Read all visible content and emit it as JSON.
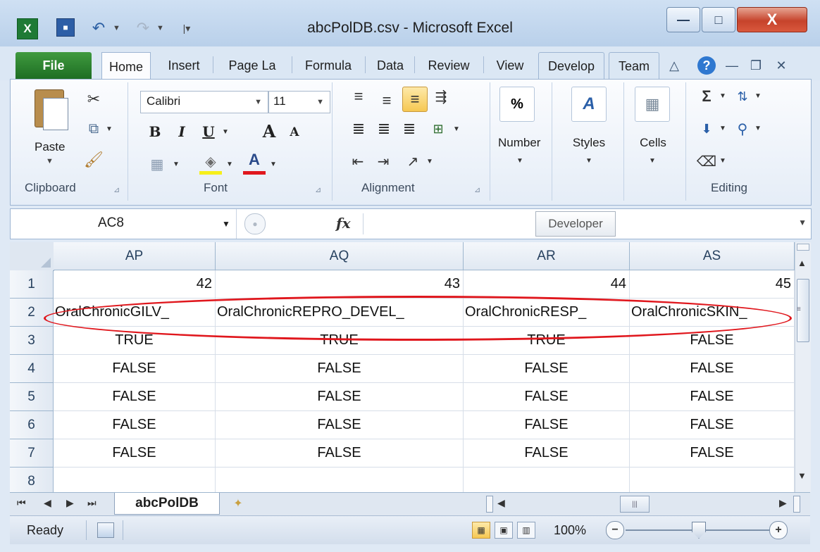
{
  "app": {
    "title": "abcPolDB.csv - Microsoft Excel",
    "logo": "X",
    "colors": {
      "excel_green": "#1f7a35",
      "annotation_red": "#e0171d",
      "ribbon_bg": "#dbe7f4"
    }
  },
  "window_controls": {
    "minimize": "—",
    "maximize": "□",
    "close": "X"
  },
  "tabs": [
    {
      "label": "File"
    },
    {
      "label": "Home"
    },
    {
      "label": "Insert"
    },
    {
      "label": "Page La"
    },
    {
      "label": "Formula"
    },
    {
      "label": "Data"
    },
    {
      "label": "Review"
    },
    {
      "label": "View"
    },
    {
      "label": "Develop"
    },
    {
      "label": "Team"
    }
  ],
  "ribbon": {
    "clipboard": {
      "label": "Clipboard",
      "paste_label": "Paste"
    },
    "font": {
      "label": "Font",
      "font_name": "Calibri",
      "font_size": "11",
      "bold": "B",
      "italic": "I",
      "underline": "U",
      "grow": "A",
      "shrink": "A"
    },
    "alignment": {
      "label": "Alignment"
    },
    "number": {
      "label": "Number",
      "icon_text": "%"
    },
    "styles": {
      "label": "Styles"
    },
    "cells": {
      "label": "Cells"
    },
    "editing": {
      "label": "Editing",
      "sum": "Σ"
    }
  },
  "formula_bar": {
    "name_box": "AC8",
    "fx": "fx",
    "formula": "",
    "tooltip": "Developer"
  },
  "sheet": {
    "columns": [
      "AP",
      "AQ",
      "AR",
      "AS"
    ],
    "rows": [
      "1",
      "2",
      "3",
      "4",
      "5",
      "6",
      "7",
      "8"
    ],
    "cells": [
      [
        "42",
        "43",
        "44",
        "45"
      ],
      [
        "OralChronicGILV_",
        "OralChronicREPRO_DEVEL_",
        "OralChronicRESP_",
        "OralChronicSKIN_"
      ],
      [
        "TRUE",
        "TRUE",
        "TRUE",
        "FALSE"
      ],
      [
        "FALSE",
        "FALSE",
        "FALSE",
        "FALSE"
      ],
      [
        "FALSE",
        "FALSE",
        "FALSE",
        "FALSE"
      ],
      [
        "FALSE",
        "FALSE",
        "FALSE",
        "FALSE"
      ],
      [
        "FALSE",
        "FALSE",
        "FALSE",
        "FALSE"
      ],
      [
        "",
        "",
        "",
        ""
      ]
    ],
    "tab_name": "abcPolDB"
  },
  "status": {
    "ready": "Ready",
    "zoom": "100%",
    "zoom_minus": "−",
    "zoom_plus": "+"
  }
}
